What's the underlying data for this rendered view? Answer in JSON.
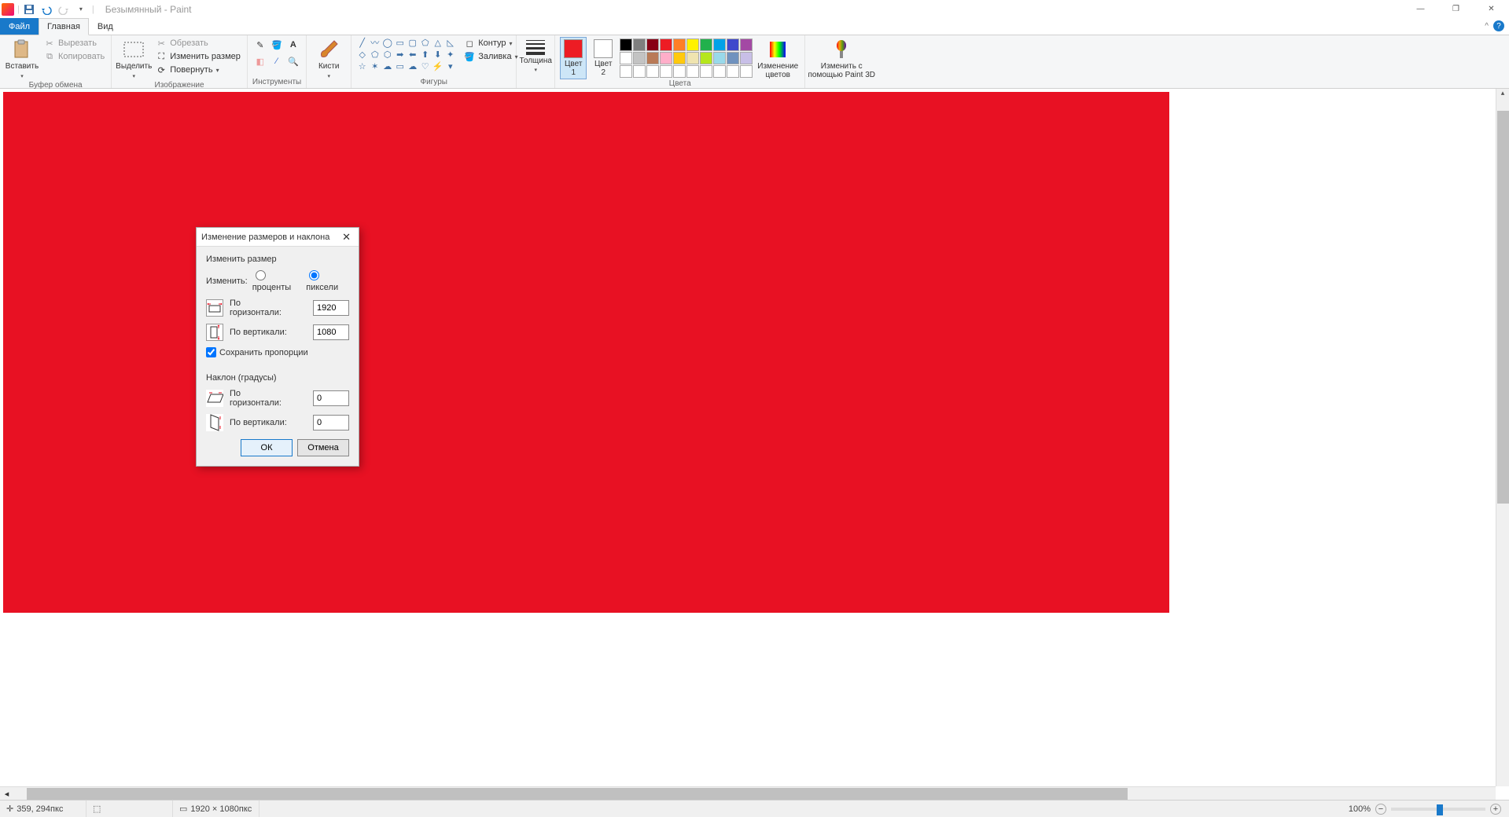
{
  "title": {
    "document": "Безымянный",
    "app": "Paint"
  },
  "window_controls": {
    "minimize": "—",
    "maximize": "▢",
    "close": "✕"
  },
  "tabs": {
    "file": "Файл",
    "home": "Главная",
    "view": "Вид"
  },
  "ribbon": {
    "clipboard": {
      "paste": "Вставить",
      "cut": "Вырезать",
      "copy": "Копировать",
      "label": "Буфер обмена"
    },
    "image": {
      "select": "Выделить",
      "crop": "Обрезать",
      "resize": "Изменить размер",
      "rotate": "Повернуть",
      "label": "Изображение"
    },
    "tools": {
      "label": "Инструменты"
    },
    "brushes": {
      "label": "Кисти"
    },
    "shapes": {
      "outline": "Контур",
      "fill": "Заливка",
      "label": "Фигуры"
    },
    "size": {
      "label": "Толщина"
    },
    "colors": {
      "color1": "Цвет\n1",
      "color2": "Цвет\n2",
      "edit": "Изменение\nцветов",
      "label": "Цвета"
    },
    "paint3d": {
      "label": "Изменить с\nпомощью Paint 3D"
    }
  },
  "palette_row1": [
    "#000000",
    "#7f7f7f",
    "#880015",
    "#ed1c24",
    "#ff7f27",
    "#fff200",
    "#22b14c",
    "#00a2e8",
    "#3f48cc",
    "#a349a4"
  ],
  "palette_row2": [
    "#ffffff",
    "#c3c3c3",
    "#b97a57",
    "#ffaec9",
    "#ffc90e",
    "#efe4b0",
    "#b5e61d",
    "#99d9ea",
    "#7092be",
    "#c8bfe7"
  ],
  "palette_row3": [
    "#ffffff",
    "#ffffff",
    "#ffffff",
    "#ffffff",
    "#ffffff",
    "#ffffff",
    "#ffffff",
    "#ffffff",
    "#ffffff",
    "#ffffff"
  ],
  "active_color1": "#ed1c24",
  "active_color2": "#ffffff",
  "dialog": {
    "title": "Изменение размеров и наклона",
    "resize_legend": "Изменить размер",
    "change_label": "Изменить:",
    "percent": "проценты",
    "pixels": "пиксели",
    "pixels_checked": true,
    "horizontal": "По\nгоризонтали:",
    "horizontal_single": "По горизонтали:",
    "vertical": "По вертикали:",
    "h_value": "1920",
    "v_value": "1080",
    "keep_aspect": "Сохранить пропорции",
    "keep_aspect_checked": true,
    "skew_legend": "Наклон (градусы)",
    "skew_h": "0",
    "skew_v": "0",
    "ok": "ОК",
    "cancel": "Отмена"
  },
  "status": {
    "cursor": "359, 294пкс",
    "canvas_size": "1920 × 1080пкс",
    "zoom": "100%"
  }
}
